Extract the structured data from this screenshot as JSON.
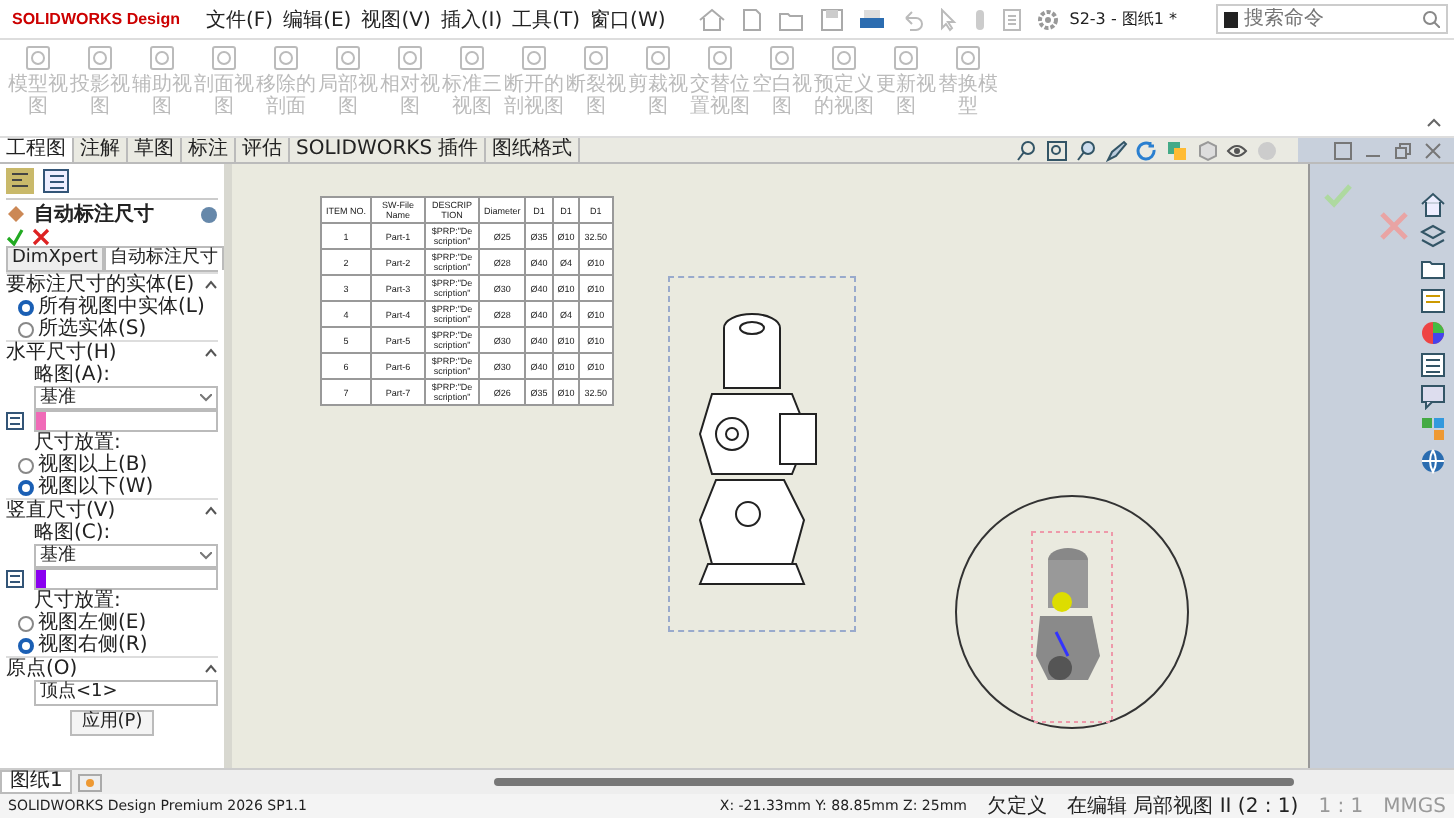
{
  "app": {
    "logo": "SOLIDWORKS Design",
    "menus": [
      "文件(F)",
      "编辑(E)",
      "视图(V)",
      "插入(I)",
      "工具(T)",
      "窗口(W)"
    ],
    "document_title": "S2-3 - 图纸1 *",
    "search": {
      "placeholder": "搜索命令"
    }
  },
  "ribbon": {
    "buttons": [
      {
        "label": "模型视图",
        "disabled": true
      },
      {
        "label": "投影视图",
        "disabled": true
      },
      {
        "label": "辅助视图",
        "disabled": true
      },
      {
        "label": "剖面视图",
        "disabled": true
      },
      {
        "label": "移除的剖面",
        "disabled": true
      },
      {
        "label": "局部视图",
        "disabled": true
      },
      {
        "label": "相对视图",
        "disabled": true
      },
      {
        "label": "标准三视图",
        "disabled": true
      },
      {
        "label": "断开的剖视图",
        "disabled": true
      },
      {
        "label": "断裂视图",
        "disabled": true
      },
      {
        "label": "剪裁视图",
        "disabled": true
      },
      {
        "label": "交替位置视图",
        "disabled": true
      },
      {
        "label": "空白视图",
        "disabled": true
      },
      {
        "label": "预定义的视图",
        "disabled": true
      },
      {
        "label": "更新视图",
        "disabled": true
      },
      {
        "label": "替换模型",
        "disabled": true
      }
    ]
  },
  "tabs": [
    {
      "label": "工程图",
      "selected": true
    },
    {
      "label": "注解",
      "selected": false
    },
    {
      "label": "草图",
      "selected": false
    },
    {
      "label": "标注",
      "selected": false
    },
    {
      "label": "评估",
      "selected": false
    },
    {
      "label": "SOLIDWORKS 插件",
      "selected": false
    },
    {
      "label": "图纸格式",
      "selected": false
    }
  ],
  "property_manager": {
    "title": "自动标注尺寸",
    "tabs": [
      {
        "label": "DimXpert",
        "selected": false
      },
      {
        "label": "自动标注尺寸",
        "selected": true
      }
    ],
    "entities": {
      "heading": "要标注尺寸的实体(E)",
      "options": [
        {
          "label": "所有视图中实体(L)",
          "selected": true
        },
        {
          "label": "所选实体(S)",
          "selected": false
        }
      ]
    },
    "sections": [
      {
        "heading": "水平尺寸(H)",
        "scheme_label": "略图(A):",
        "scheme": "基准",
        "color": "#f06bb8",
        "placement_label": "尺寸放置:",
        "options": [
          {
            "label": "视图以上(B)",
            "selected": false
          },
          {
            "label": "视图以下(W)",
            "selected": true
          }
        ]
      },
      {
        "heading": "竖直尺寸(V)",
        "scheme_label": "略图(C):",
        "scheme": "基准",
        "color": "#8a00f0",
        "placement_label": "尺寸放置:",
        "options": [
          {
            "label": "视图左侧(E)",
            "selected": false
          },
          {
            "label": "视图右侧(R)",
            "selected": true
          }
        ]
      }
    ],
    "origin": {
      "heading": "原点(O)",
      "value": "顶点<1>",
      "apply": "应用(P)"
    }
  },
  "bom": {
    "columns": [
      "ITEM NO.",
      "SW-File Name",
      "DESCRIPTION",
      "Diameter",
      "D1",
      "D1",
      "D1"
    ],
    "rows": [
      [
        "1",
        "Part-1",
        "$PRP:\"Description\"",
        "Ø25",
        "Ø35",
        "Ø10",
        "32.50"
      ],
      [
        "2",
        "Part-2",
        "$PRP:\"Description\"",
        "Ø28",
        "Ø40",
        "Ø4",
        "Ø10"
      ],
      [
        "3",
        "Part-3",
        "$PRP:\"Description\"",
        "Ø30",
        "Ø40",
        "Ø10",
        "Ø10"
      ],
      [
        "4",
        "Part-4",
        "$PRP:\"Description\"",
        "Ø28",
        "Ø40",
        "Ø4",
        "Ø10"
      ],
      [
        "5",
        "Part-5",
        "$PRP:\"Description\"",
        "Ø30",
        "Ø40",
        "Ø10",
        "Ø10"
      ],
      [
        "6",
        "Part-6",
        "$PRP:\"Description\"",
        "Ø30",
        "Ø40",
        "Ø10",
        "Ø10"
      ],
      [
        "7",
        "Part-7",
        "$PRP:\"Description\"",
        "Ø26",
        "Ø35",
        "Ø10",
        "32.50"
      ]
    ]
  },
  "sheet_tabs": [
    {
      "label": "图纸1",
      "selected": true
    }
  ],
  "status_bar": {
    "product": "SOLIDWORKS Design Premium 2026 SP1.1",
    "coordinates": "X: -21.33mm Y: 88.85mm Z: 25mm",
    "definition": "欠定义",
    "editing": "在编辑 局部视图 II (2 : 1)",
    "scale": "1 : 1",
    "units": "MMGS"
  }
}
